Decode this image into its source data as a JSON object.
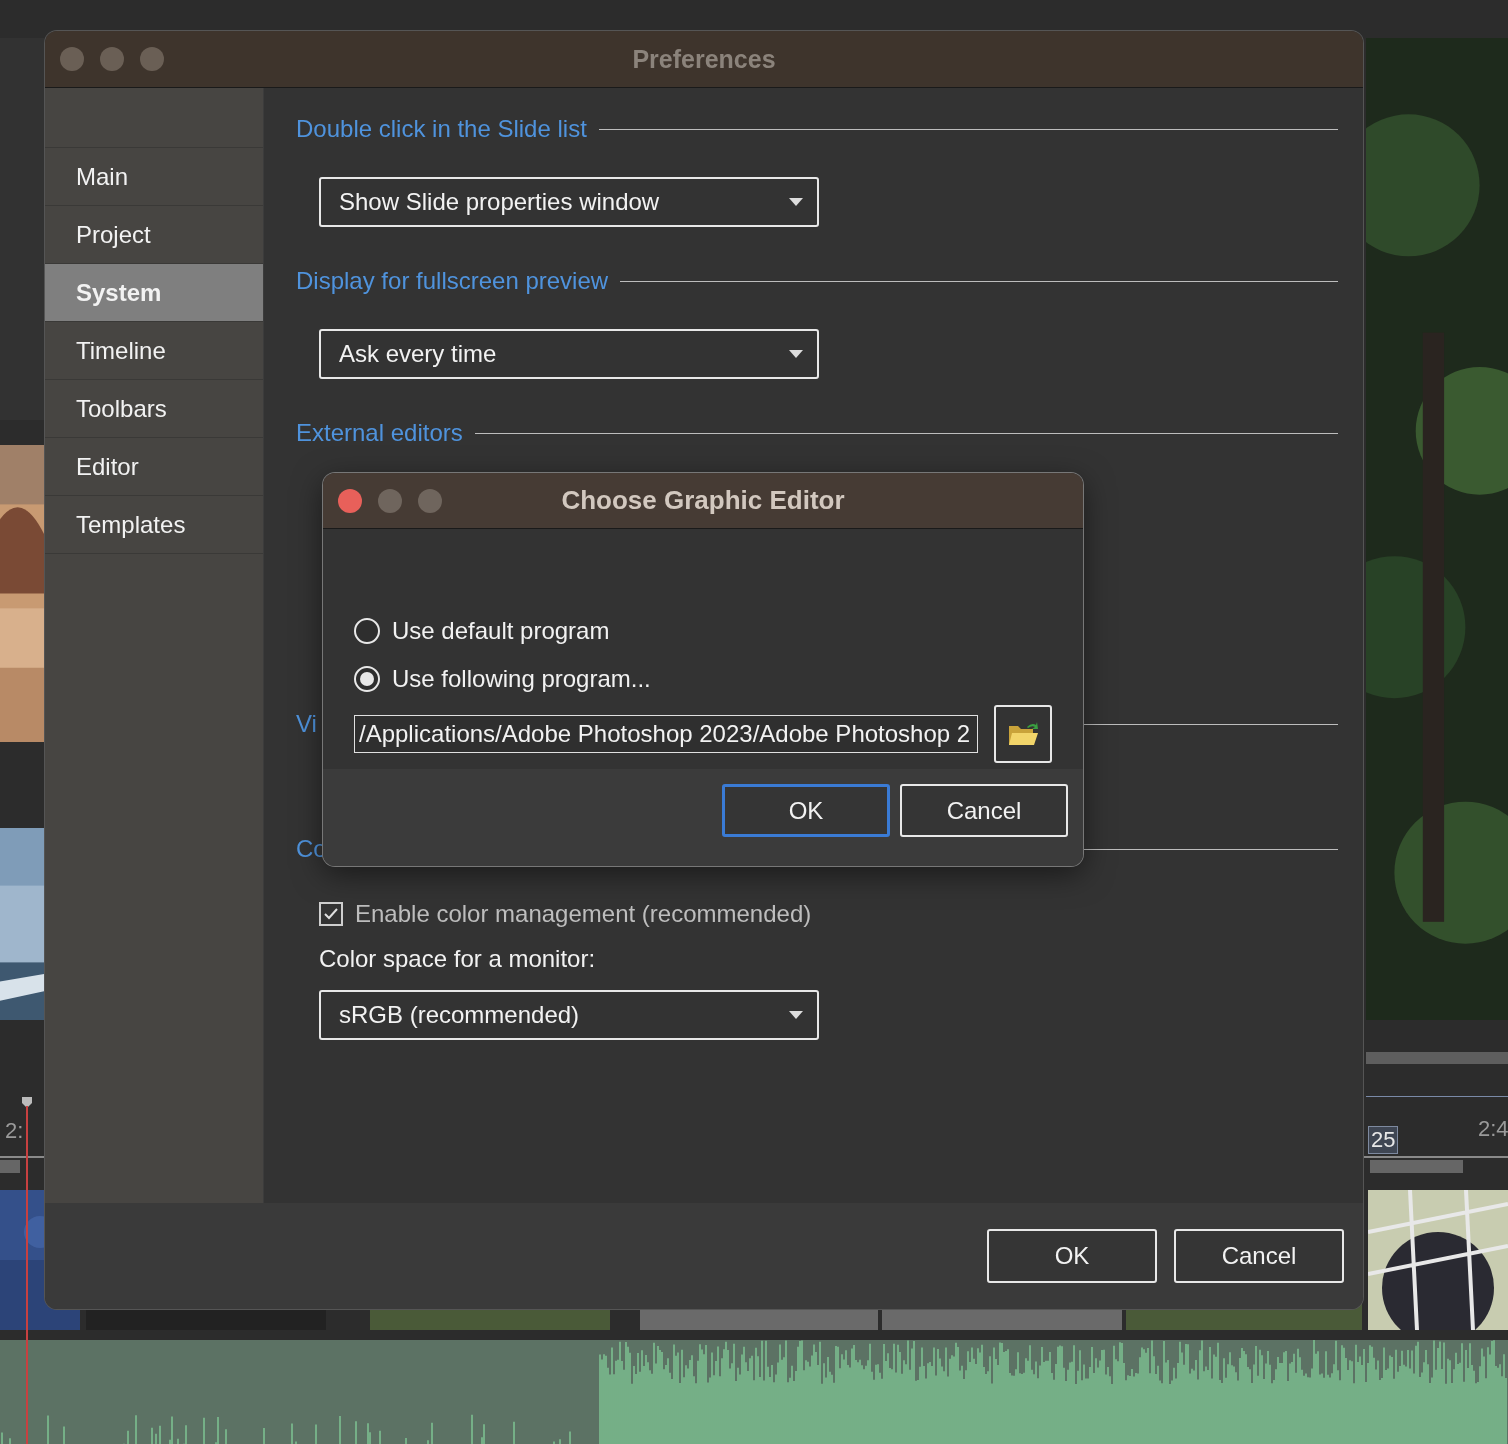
{
  "background": {
    "timeline": {
      "time_labels": [
        "2:",
        "2:4"
      ],
      "marker": "25"
    }
  },
  "preferences": {
    "title": "Preferences",
    "sidebar": {
      "items": [
        {
          "label": "Main",
          "selected": false
        },
        {
          "label": "Project",
          "selected": false
        },
        {
          "label": "System",
          "selected": true
        },
        {
          "label": "Timeline",
          "selected": false
        },
        {
          "label": "Toolbars",
          "selected": false
        },
        {
          "label": "Editor",
          "selected": false
        },
        {
          "label": "Templates",
          "selected": false
        }
      ]
    },
    "sections": [
      {
        "kind": "dropdown",
        "header": "Double click in the Slide list",
        "value": "Show Slide properties window"
      },
      {
        "kind": "dropdown",
        "header": "Display for fullscreen preview",
        "value": "Ask every time"
      },
      {
        "kind": "header",
        "header": "External editors"
      },
      {
        "kind": "header",
        "header": "Vi"
      },
      {
        "kind": "color",
        "header": "Co",
        "checkbox": {
          "label": "Enable color management (recommended)",
          "checked": true
        },
        "label": "Color space for a monitor:",
        "value": "sRGB (recommended)"
      }
    ],
    "buttons": [
      {
        "label": "OK"
      },
      {
        "label": "Cancel"
      }
    ]
  },
  "dialog": {
    "title": "Choose Graphic Editor",
    "options": [
      {
        "label": "Use default program",
        "selected": false
      },
      {
        "label": "Use following program...",
        "selected": true
      }
    ],
    "path": "/Applications/Adobe Photoshop 2023/Adobe Photoshop 2",
    "buttons": [
      {
        "label": "OK",
        "default": true
      },
      {
        "label": "Cancel",
        "default": false
      }
    ]
  }
}
